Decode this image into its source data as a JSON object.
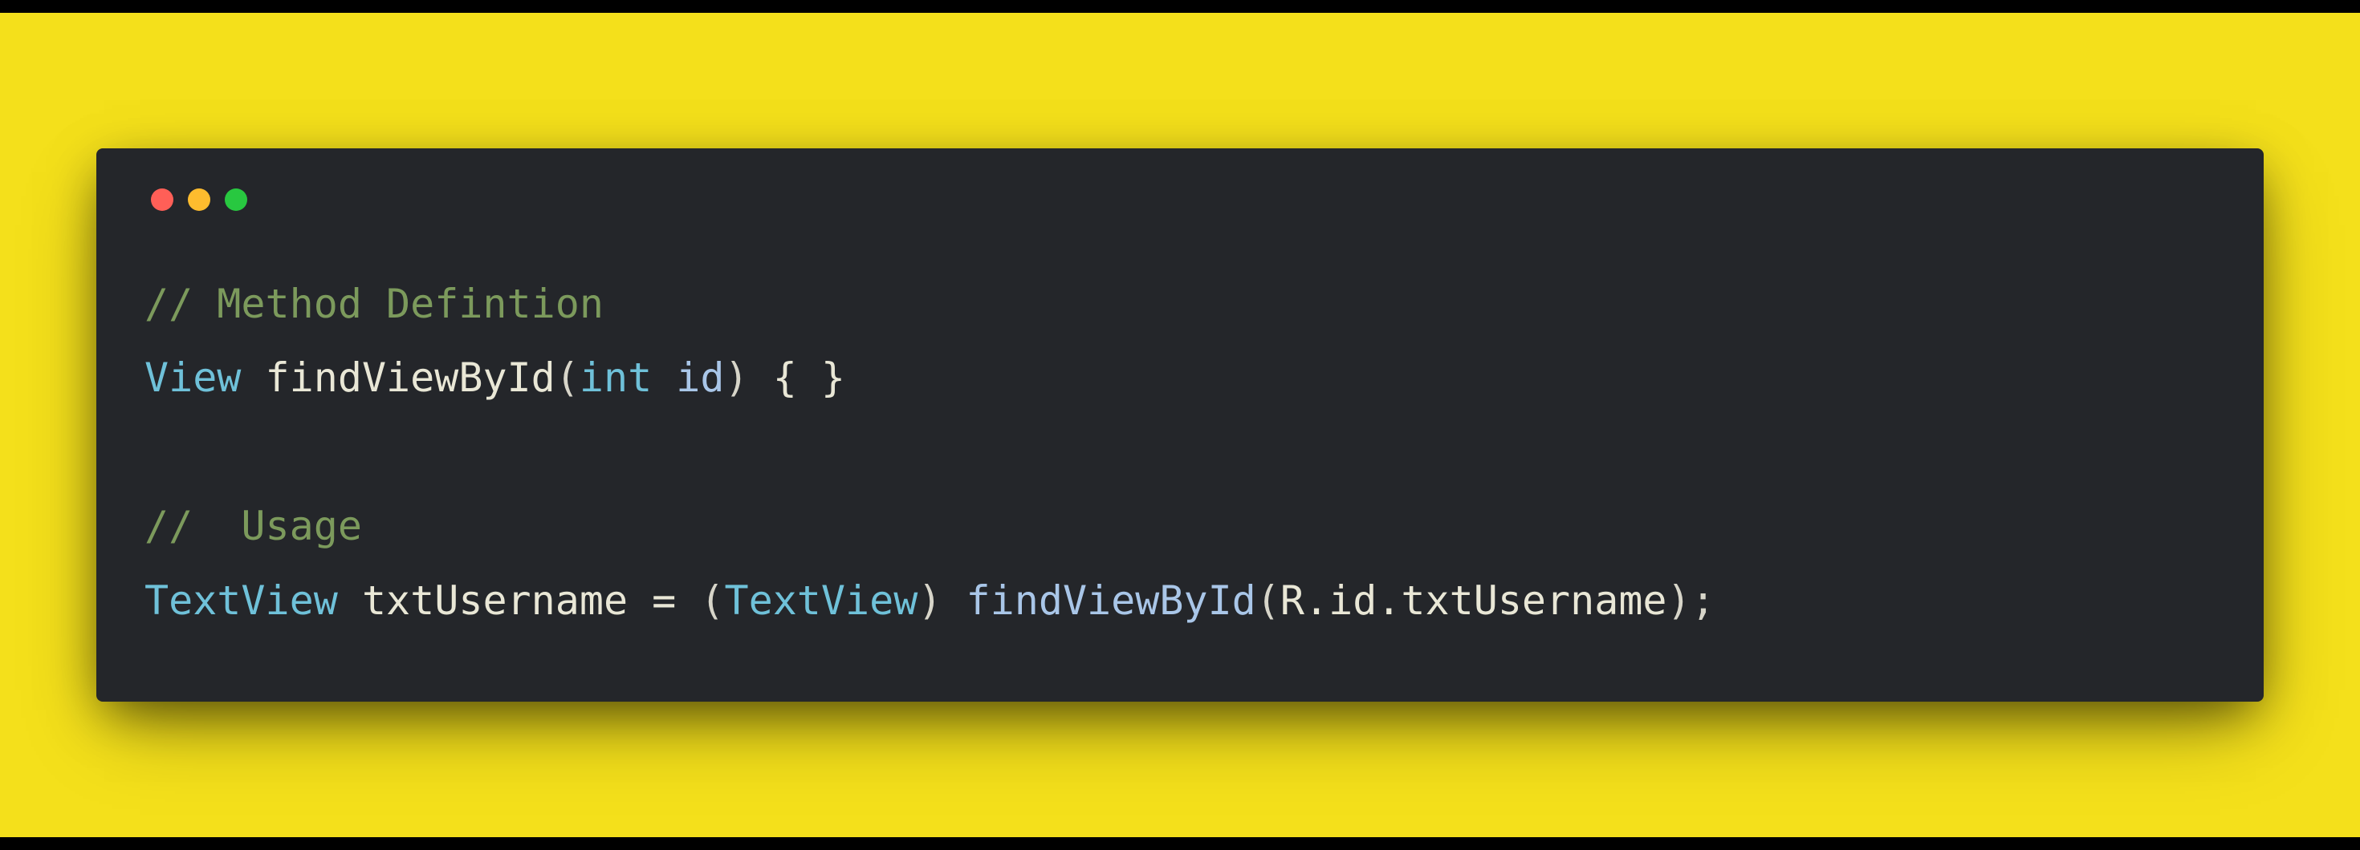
{
  "colors": {
    "background_outer": "#f4e01b",
    "background_window": "#24262a",
    "dot_red": "#ff5f57",
    "dot_yellow": "#febc2e",
    "dot_green": "#28c840",
    "comment": "#7c9a5c",
    "type": "#6fc1d9",
    "func": "#e9e7d6",
    "ident": "#a9c6e8"
  },
  "code": {
    "comment1_text": "// Method Defintion",
    "line2": {
      "return_type": "View",
      "method_name": "findViewById",
      "paren_open": "(",
      "param_type": "int",
      "param_name": "id",
      "paren_close": ")",
      "body": " { }"
    },
    "blank_line": " ",
    "comment2_text": "//  Usage",
    "line5": {
      "decl_type": "TextView",
      "var_name": "txtUsername",
      "eq": " = ",
      "cast_open": "(",
      "cast_type": "TextView",
      "cast_close": ")",
      "call_name": "findViewById",
      "call_open": "(",
      "arg": "R.id.txtUsername",
      "call_close": ")",
      "semi": ";"
    }
  }
}
